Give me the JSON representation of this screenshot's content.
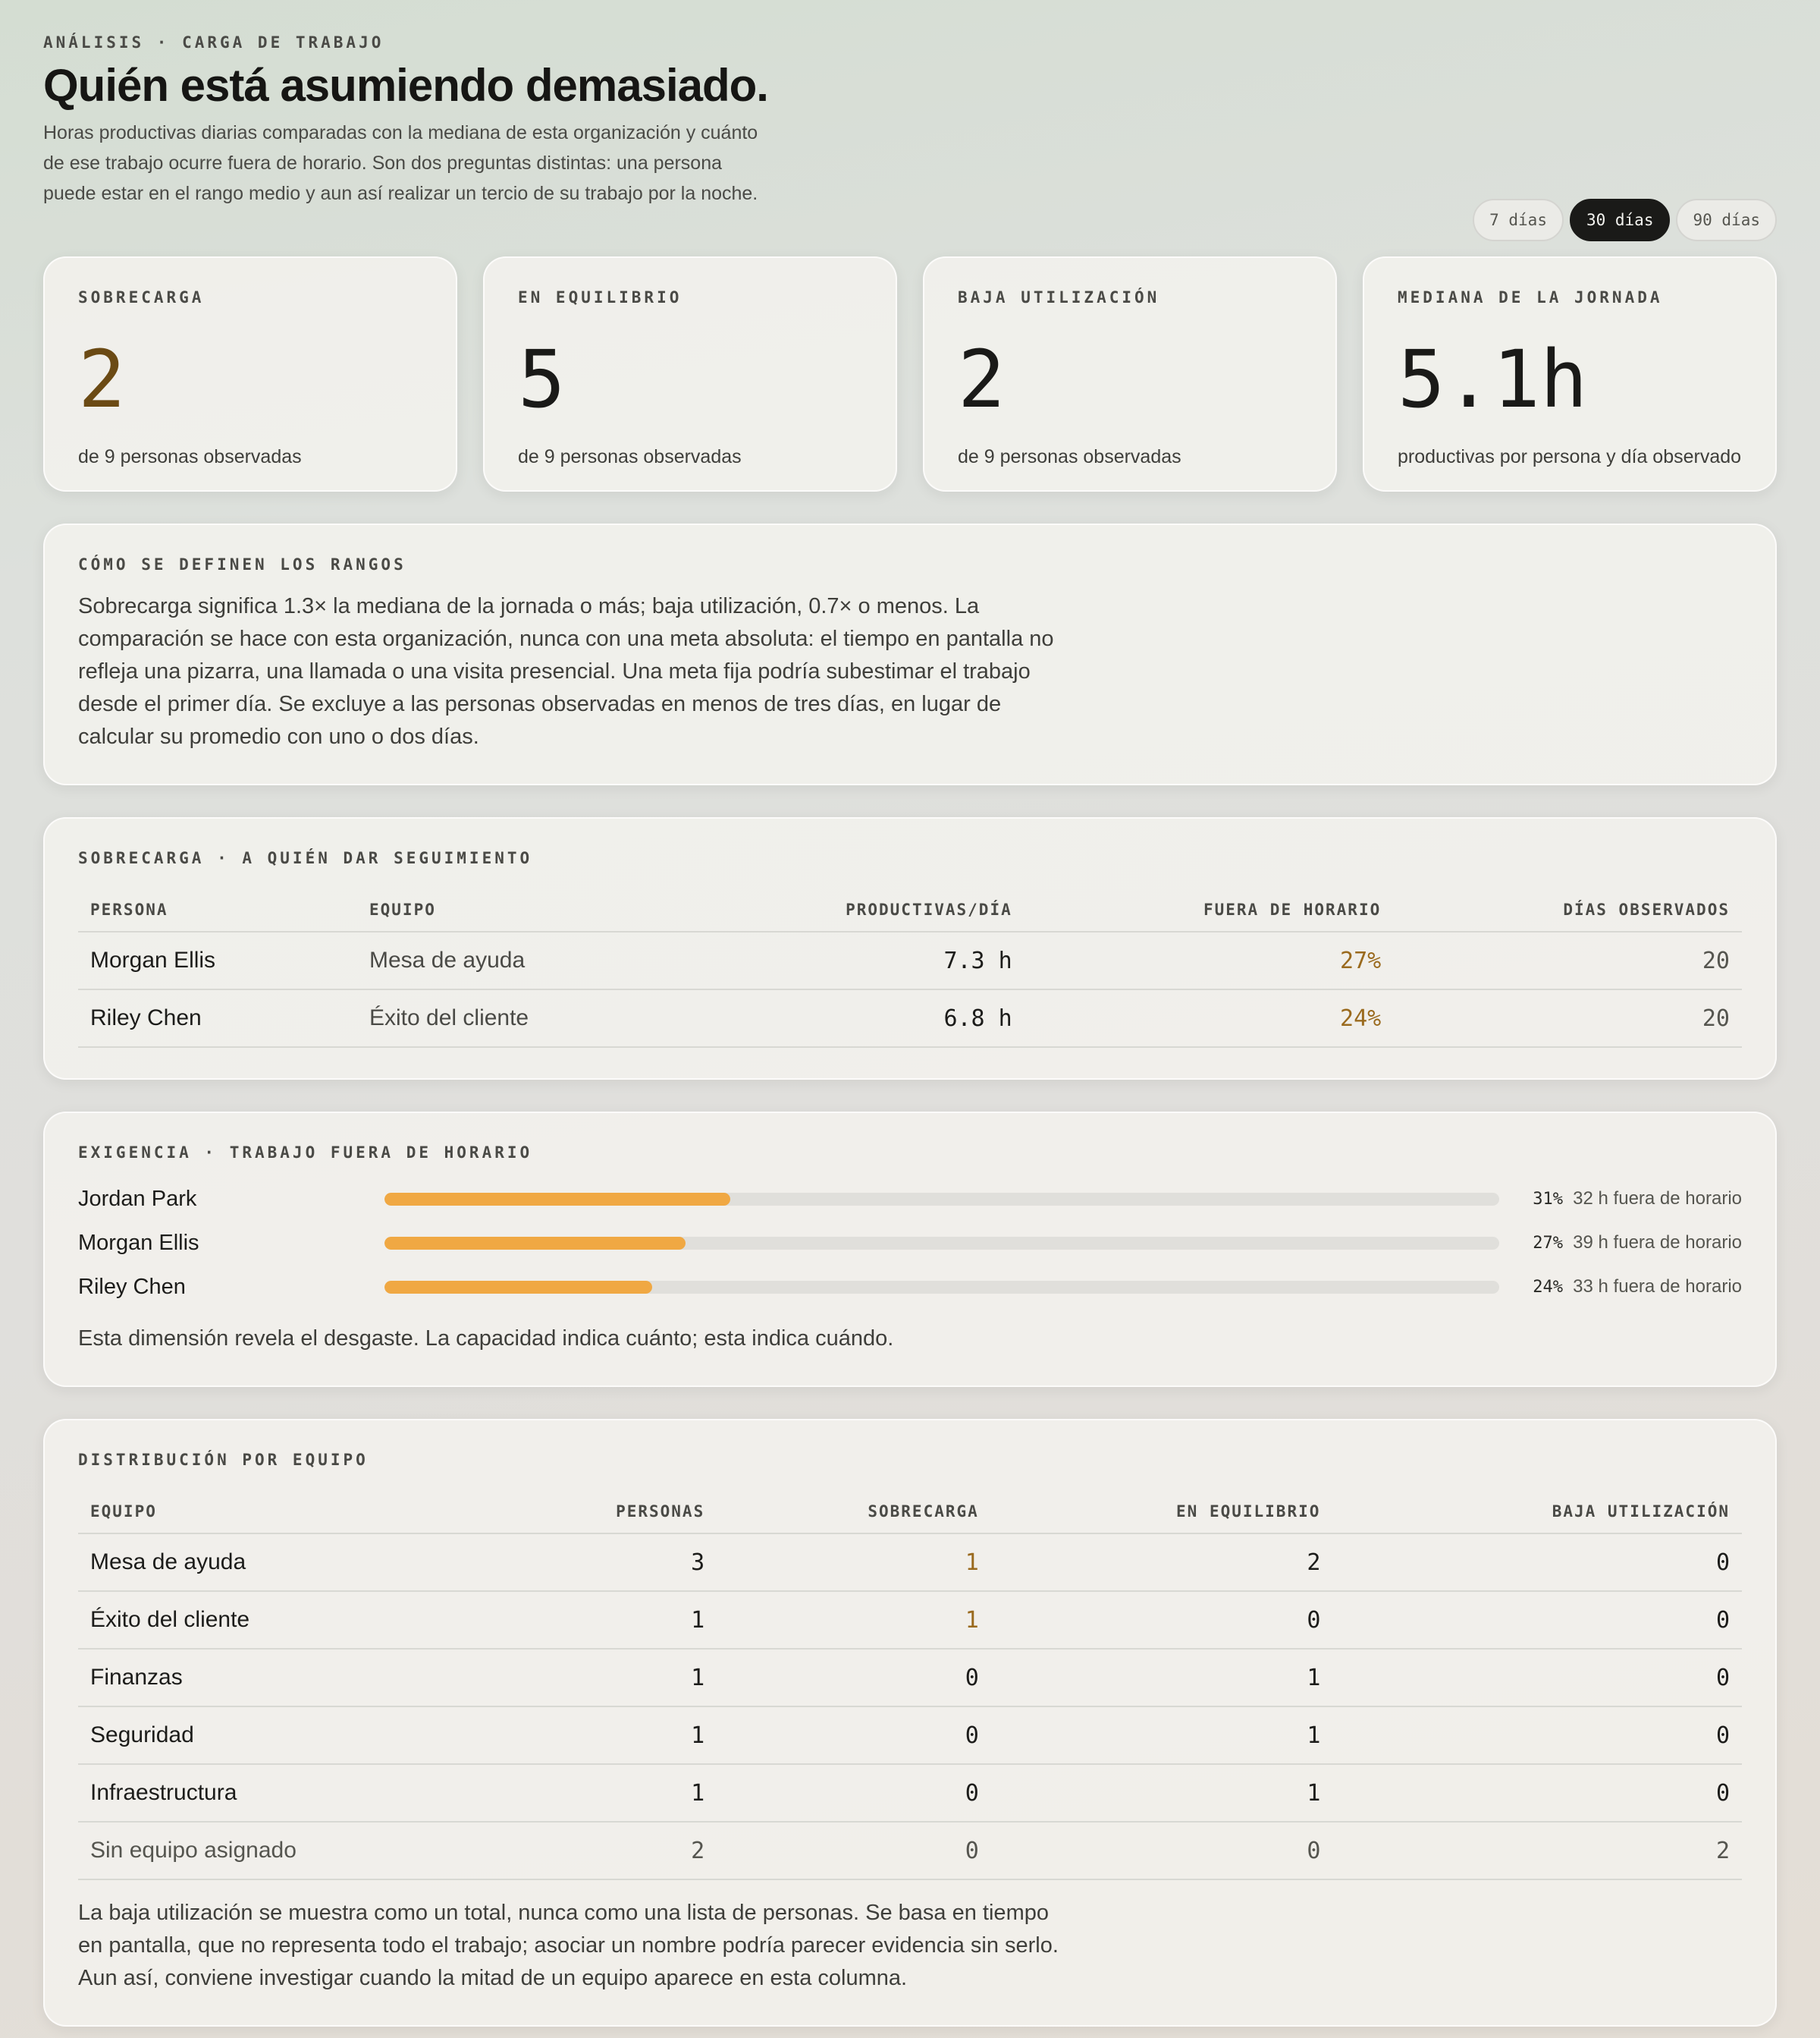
{
  "header": {
    "eyebrow": "ANÁLISIS · CARGA DE TRABAJO",
    "title": "Quién está asumiendo demasiado.",
    "subtitle": "Horas productivas diarias comparadas con la mediana de esta organización y cuánto de ese trabajo ocurre fuera de horario. Son dos preguntas distintas: una persona puede estar en el rango medio y aun así realizar un tercio de su trabajo por la noche."
  },
  "ranges": [
    {
      "label": "7 días",
      "active": false
    },
    {
      "label": "30 días",
      "active": true
    },
    {
      "label": "90 días",
      "active": false
    }
  ],
  "stats": [
    {
      "label": "SOBRECARGA",
      "value": "2",
      "sub": "de 9 personas observadas"
    },
    {
      "label": "EN EQUILIBRIO",
      "value": "5",
      "sub": "de 9 personas observadas"
    },
    {
      "label": "BAJA UTILIZACIÓN",
      "value": "2",
      "sub": "de 9 personas observadas"
    },
    {
      "label": "MEDIANA DE LA JORNADA",
      "value": "5.1h",
      "sub": "productivas por persona y día observado"
    }
  ],
  "definitions": {
    "title": "CÓMO SE DEFINEN LOS RANGOS",
    "text": "Sobrecarga significa 1.3× la mediana de la jornada o más; baja utilización, 0.7× o menos. La comparación se hace con esta organización, nunca con una meta absoluta: el tiempo en pantalla no refleja una pizarra, una llamada o una visita presencial. Una meta fija podría subestimar el trabajo desde el primer día. Se excluye a las personas observadas en menos de tres días, en lugar de calcular su promedio con uno o dos días."
  },
  "overload": {
    "title": "SOBRECARGA · A QUIÉN DAR SEGUIMIENTO",
    "columns": [
      "PERSONA",
      "EQUIPO",
      "PRODUCTIVAS/DÍA",
      "FUERA DE HORARIO",
      "DÍAS OBSERVADOS"
    ],
    "rows": [
      {
        "person": "Morgan Ellis",
        "team": "Mesa de ayuda",
        "hours": "7.3 h",
        "after": "27%",
        "days": "20"
      },
      {
        "person": "Riley Chen",
        "team": "Éxito del cliente",
        "hours": "6.8 h",
        "after": "24%",
        "days": "20"
      }
    ]
  },
  "demand": {
    "title": "EXIGENCIA · TRABAJO FUERA DE HORARIO",
    "rows": [
      {
        "name": "Jordan Park",
        "fraction": 0.31,
        "pct": "31%",
        "note": "32 h fuera de horario"
      },
      {
        "name": "Morgan Ellis",
        "fraction": 0.27,
        "pct": "27%",
        "note": "39 h fuera de horario"
      },
      {
        "name": "Riley Chen",
        "fraction": 0.24,
        "pct": "24%",
        "note": "33 h fuera de horario"
      }
    ],
    "text": "Esta dimensión revela el desgaste. La capacidad indica cuánto; esta indica cuándo."
  },
  "distribution": {
    "title": "DISTRIBUCIÓN POR EQUIPO",
    "columns": [
      "EQUIPO",
      "PERSONAS",
      "SOBRECARGA",
      "EN EQUILIBRIO",
      "BAJA UTILIZACIÓN"
    ],
    "rows": [
      {
        "team": "Mesa de ayuda",
        "people": "3",
        "over": "1",
        "balanced": "2",
        "low": "0"
      },
      {
        "team": "Éxito del cliente",
        "people": "1",
        "over": "1",
        "balanced": "0",
        "low": "0"
      },
      {
        "team": "Finanzas",
        "people": "1",
        "over": "0",
        "balanced": "1",
        "low": "0"
      },
      {
        "team": "Seguridad",
        "people": "1",
        "over": "0",
        "balanced": "1",
        "low": "0"
      },
      {
        "team": "Infraestructura",
        "people": "1",
        "over": "0",
        "balanced": "1",
        "low": "0"
      },
      {
        "team": "Sin equipo asignado",
        "people": "2",
        "over": "0",
        "balanced": "0",
        "low": "2"
      }
    ],
    "text": "La baja utilización se muestra como un total, nunca como una lista de personas. Se basa en tiempo en pantalla, que no representa todo el trabajo; asociar un nombre podría parecer evidencia sin serlo. Aun así, conviene investigar cuando la mitad de un equipo aparece en esta columna."
  },
  "colors": {
    "accent_bar": "#f0a843",
    "amber_text": "#9a6a1e",
    "active_pill": "#1a1a18"
  }
}
